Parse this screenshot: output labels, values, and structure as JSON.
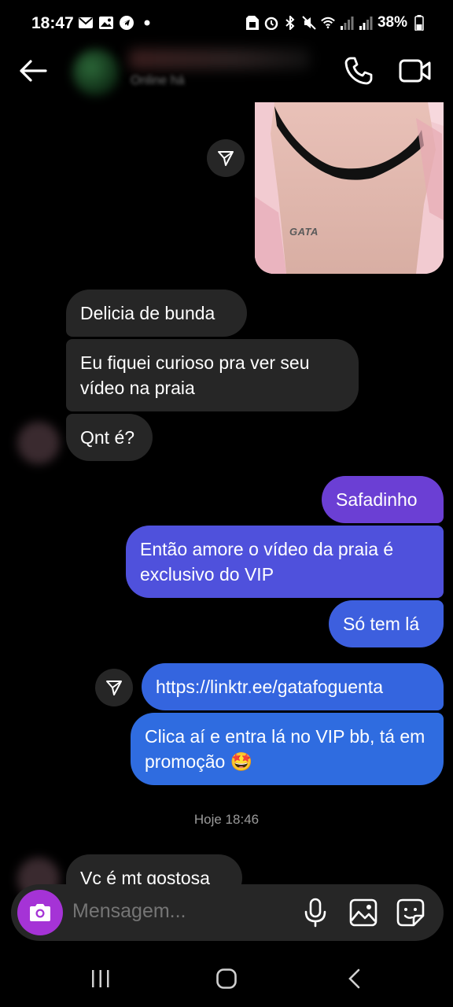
{
  "status_bar": {
    "time": "18:47",
    "battery": "38%"
  },
  "header": {
    "status_text": "Online há"
  },
  "photo": {
    "watermark": "GATA"
  },
  "messages": [
    {
      "text": "Delicia de bunda"
    },
    {
      "text": "Eu fiquei curioso pra ver seu vídeo na praia"
    },
    {
      "text": "Qnt é?"
    },
    {
      "text": "Safadinho"
    },
    {
      "text": "Então amore o vídeo da praia é exclusivo do VIP"
    },
    {
      "text": "Só tem lá"
    },
    {
      "text": "https://linktr.ee/gatafoguenta"
    },
    {
      "text": "Clica aí e entra lá no VIP bb, tá em promoção 🤩"
    },
    {
      "text": "Vc é mt gostosa"
    }
  ],
  "timestamp": "Hoje 18:46",
  "composer": {
    "placeholder": "Mensagem..."
  },
  "colors": {
    "received_bubble": "#262626",
    "sent_purple": "#6b3fd4",
    "sent_blue": "#2f6ce0",
    "camera_button": "#a533d6",
    "background": "#000000"
  }
}
